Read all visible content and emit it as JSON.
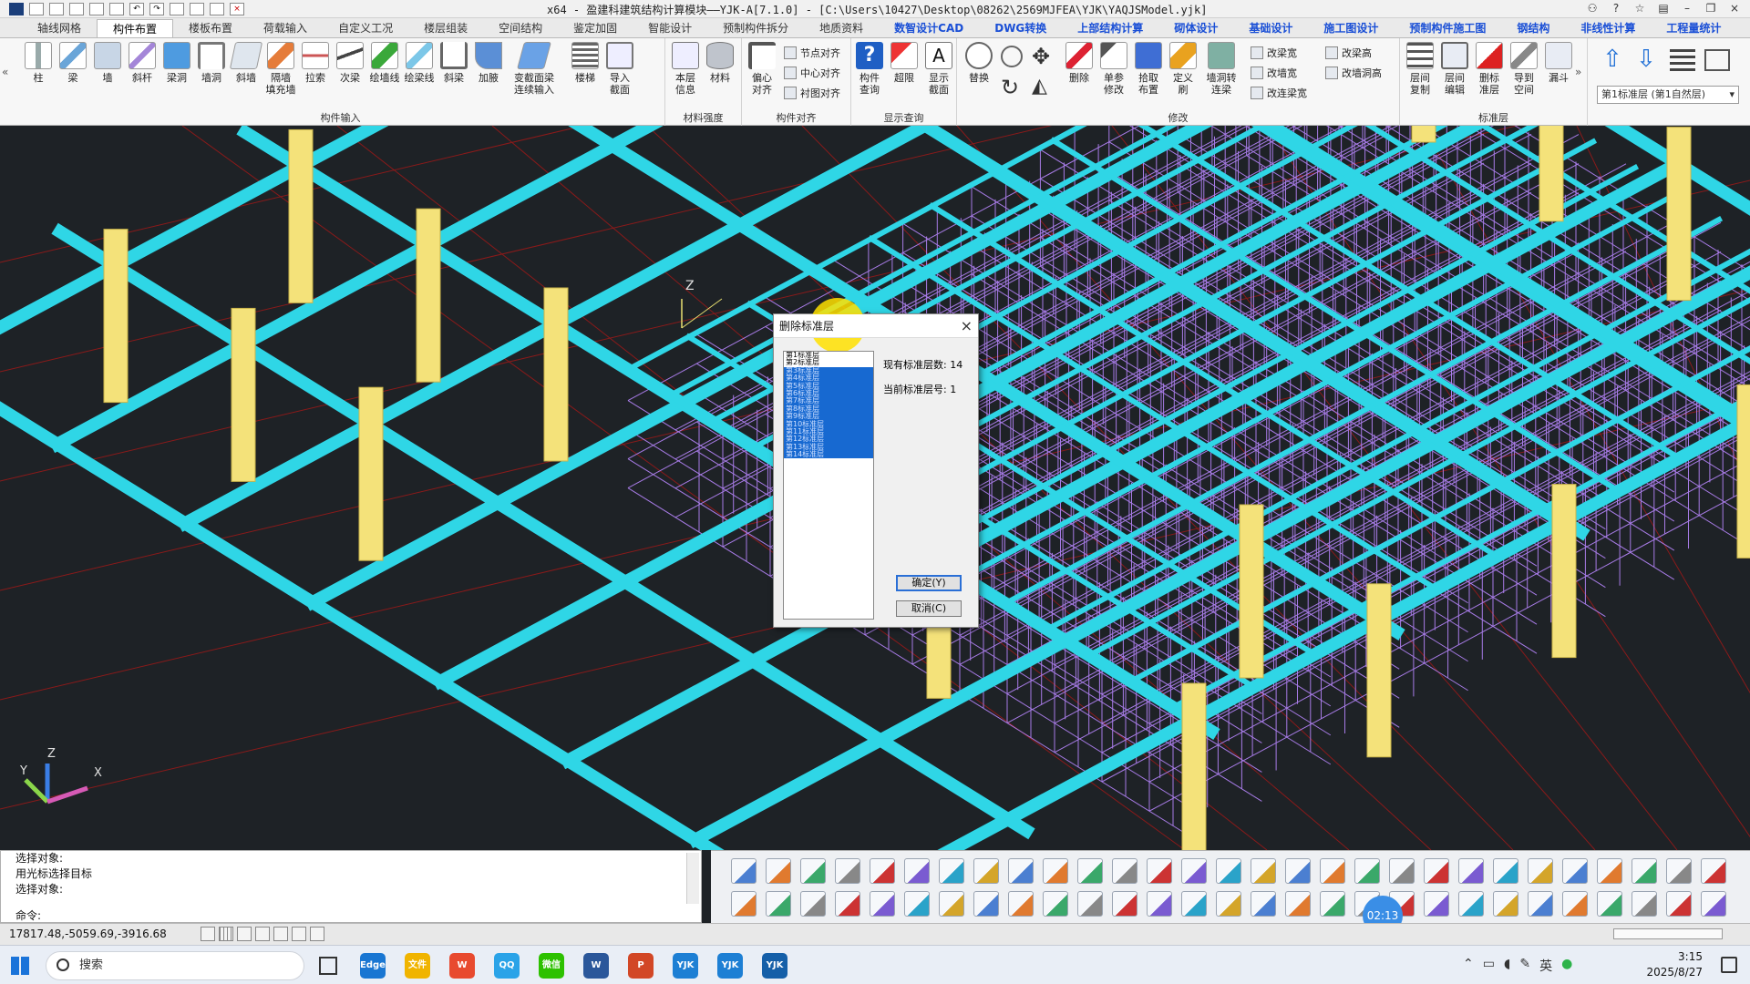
{
  "window": {
    "title": "x64 - 盈建科建筑结构计算模块——YJK-A[7.1.0] - [C:\\Users\\10427\\Desktop\\08262\\2569MJFEA\\YJK\\YAQJSModel.yjk]"
  },
  "tabs": [
    {
      "label": "轴线网格"
    },
    {
      "label": "构件布置"
    },
    {
      "label": "楼板布置"
    },
    {
      "label": "荷载输入"
    },
    {
      "label": "自定义工况"
    },
    {
      "label": "楼层组装"
    },
    {
      "label": "空间结构"
    },
    {
      "label": "鉴定加固"
    },
    {
      "label": "智能设计"
    },
    {
      "label": "预制构件拆分"
    },
    {
      "label": "地质资料"
    },
    {
      "label": "数智设计CAD"
    },
    {
      "label": "DWG转换"
    },
    {
      "label": "上部结构计算"
    },
    {
      "label": "砌体设计"
    },
    {
      "label": "基础设计"
    },
    {
      "label": "施工图设计"
    },
    {
      "label": "预制构件施工图"
    },
    {
      "label": "钢结构"
    },
    {
      "label": "非线性计算"
    },
    {
      "label": "工程量统计"
    }
  ],
  "ribbon": {
    "component_input": {
      "label": "构件输入",
      "buttons": [
        {
          "label": "柱"
        },
        {
          "label": "梁"
        },
        {
          "label": "墙"
        },
        {
          "label": "斜杆"
        },
        {
          "label": "梁洞"
        },
        {
          "label": "墙洞"
        },
        {
          "label": "斜墙"
        },
        {
          "label": "隔墙\n填充墙"
        },
        {
          "label": "拉索"
        },
        {
          "label": "次梁"
        },
        {
          "label": "绘墙线"
        },
        {
          "label": "绘梁线"
        },
        {
          "label": "斜梁"
        },
        {
          "label": "加腋"
        },
        {
          "label": "变截面梁\n连续输入"
        },
        {
          "label": "楼梯"
        },
        {
          "label": "导入\n截面"
        }
      ]
    },
    "material": {
      "label": "材料强度",
      "buttons": [
        {
          "label": "本层\n信息"
        },
        {
          "label": "材料"
        }
      ]
    },
    "align": {
      "label": "构件对齐",
      "big": {
        "label": "偏心\n对齐"
      },
      "small": [
        {
          "label": "节点对齐"
        },
        {
          "label": "中心对齐"
        },
        {
          "label": "衬图对齐"
        }
      ]
    },
    "display": {
      "label": "显示查询",
      "buttons": [
        {
          "label": "构件\n查询"
        },
        {
          "label": "超限"
        },
        {
          "label": "显示\n截面"
        }
      ]
    },
    "modify": {
      "label": "修改",
      "buttons": [
        {
          "label": "替换"
        },
        {
          "label": "删除"
        },
        {
          "label": "单参\n修改"
        },
        {
          "label": "拾取\n布置"
        },
        {
          "label": "定义\n刷"
        },
        {
          "label": "墙洞转\n连梁"
        }
      ],
      "small": [
        {
          "label": "改梁宽"
        },
        {
          "label": "改梁高"
        },
        {
          "label": "改墙宽"
        },
        {
          "label": "改墙洞高"
        },
        {
          "label": "改连梁宽"
        }
      ]
    },
    "std_layer": {
      "label": "标准层",
      "buttons": [
        {
          "label": "层间\n复制"
        },
        {
          "label": "层间\n编辑"
        },
        {
          "label": "删标\n准层"
        },
        {
          "label": "导到\n空间"
        },
        {
          "label": "漏斗"
        }
      ]
    },
    "layer_select": "第1标准层 (第1自然层)"
  },
  "dialog": {
    "title": "删除标准层",
    "layers": [
      {
        "label": "第1标准层",
        "selected": false
      },
      {
        "label": "第2标准层",
        "selected": false
      },
      {
        "label": "第3标准层",
        "selected": true
      },
      {
        "label": "第4标准层",
        "selected": true
      },
      {
        "label": "第5标准层",
        "selected": true
      },
      {
        "label": "第6标准层",
        "selected": true
      },
      {
        "label": "第7标准层",
        "selected": true
      },
      {
        "label": "第8标准层",
        "selected": true
      },
      {
        "label": "第9标准层",
        "selected": true
      },
      {
        "label": "第10标准层",
        "selected": true
      },
      {
        "label": "第11标准层",
        "selected": true
      },
      {
        "label": "第12标准层",
        "selected": true
      },
      {
        "label": "第13标准层",
        "selected": true
      },
      {
        "label": "第14标准层",
        "selected": true
      }
    ],
    "count_label": "现有标准层数: 14",
    "current_label": "当前标准层号: 1",
    "ok_label": "确定(Y)",
    "cancel_label": "取消(C)"
  },
  "viewport": {
    "axis_z_label": "Z",
    "axis_x_label": "X",
    "axis_y_label": "Y",
    "colors": {
      "background": "#1e2226",
      "beam": "#2fd6e6",
      "column": "#f4e27a",
      "scaffold": "#a77be6",
      "gridline": "#8a1a1a"
    }
  },
  "command": {
    "lines": [
      "选择对象:",
      "用光标选择目标",
      "选择对象:"
    ],
    "prompt": "命令:"
  },
  "status": {
    "coords": "17817.48,-5059.69,-3916.68"
  },
  "timer": "02:13",
  "taskbar": {
    "search_placeholder": "搜索",
    "apps": [
      {
        "label": "Edge",
        "color": "#1976d2"
      },
      {
        "label": "文件",
        "color": "#f0b400"
      },
      {
        "label": "W",
        "color": "#e84a2f"
      },
      {
        "label": "QQ",
        "color": "#2aa3e8"
      },
      {
        "label": "微信",
        "color": "#2dc100"
      },
      {
        "label": "W",
        "color": "#2b579a"
      },
      {
        "label": "P",
        "color": "#d24726"
      },
      {
        "label": "YJK",
        "color": "#1d7fd4"
      },
      {
        "label": "YJK",
        "color": "#1d7fd4"
      },
      {
        "label": "YJK",
        "color": "#155fa8"
      }
    ],
    "ime": "英",
    "time": "3:15",
    "date": "2025/8/27"
  }
}
